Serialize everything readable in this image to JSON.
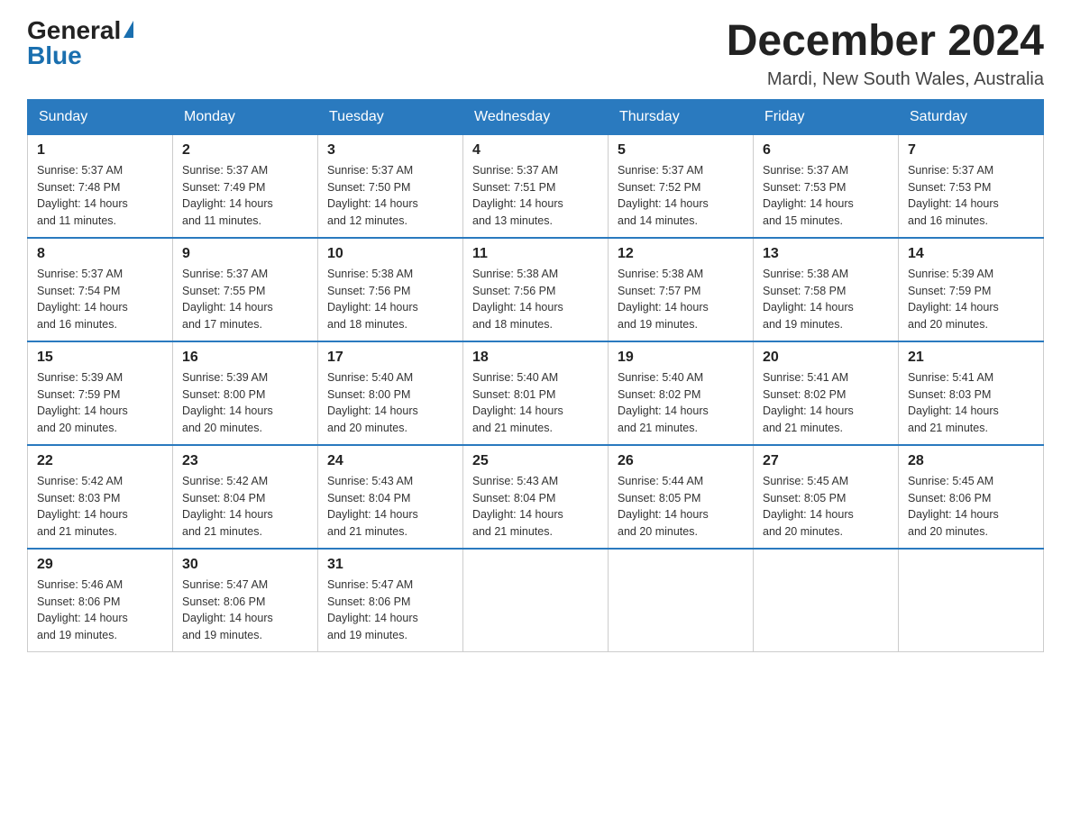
{
  "header": {
    "logo_general": "General",
    "logo_blue": "Blue",
    "month_title": "December 2024",
    "location": "Mardi, New South Wales, Australia"
  },
  "weekdays": [
    "Sunday",
    "Monday",
    "Tuesday",
    "Wednesday",
    "Thursday",
    "Friday",
    "Saturday"
  ],
  "weeks": [
    [
      {
        "day": "1",
        "sunrise": "5:37 AM",
        "sunset": "7:48 PM",
        "daylight": "14 hours and 11 minutes."
      },
      {
        "day": "2",
        "sunrise": "5:37 AM",
        "sunset": "7:49 PM",
        "daylight": "14 hours and 11 minutes."
      },
      {
        "day": "3",
        "sunrise": "5:37 AM",
        "sunset": "7:50 PM",
        "daylight": "14 hours and 12 minutes."
      },
      {
        "day": "4",
        "sunrise": "5:37 AM",
        "sunset": "7:51 PM",
        "daylight": "14 hours and 13 minutes."
      },
      {
        "day": "5",
        "sunrise": "5:37 AM",
        "sunset": "7:52 PM",
        "daylight": "14 hours and 14 minutes."
      },
      {
        "day": "6",
        "sunrise": "5:37 AM",
        "sunset": "7:53 PM",
        "daylight": "14 hours and 15 minutes."
      },
      {
        "day": "7",
        "sunrise": "5:37 AM",
        "sunset": "7:53 PM",
        "daylight": "14 hours and 16 minutes."
      }
    ],
    [
      {
        "day": "8",
        "sunrise": "5:37 AM",
        "sunset": "7:54 PM",
        "daylight": "14 hours and 16 minutes."
      },
      {
        "day": "9",
        "sunrise": "5:37 AM",
        "sunset": "7:55 PM",
        "daylight": "14 hours and 17 minutes."
      },
      {
        "day": "10",
        "sunrise": "5:38 AM",
        "sunset": "7:56 PM",
        "daylight": "14 hours and 18 minutes."
      },
      {
        "day": "11",
        "sunrise": "5:38 AM",
        "sunset": "7:56 PM",
        "daylight": "14 hours and 18 minutes."
      },
      {
        "day": "12",
        "sunrise": "5:38 AM",
        "sunset": "7:57 PM",
        "daylight": "14 hours and 19 minutes."
      },
      {
        "day": "13",
        "sunrise": "5:38 AM",
        "sunset": "7:58 PM",
        "daylight": "14 hours and 19 minutes."
      },
      {
        "day": "14",
        "sunrise": "5:39 AM",
        "sunset": "7:59 PM",
        "daylight": "14 hours and 20 minutes."
      }
    ],
    [
      {
        "day": "15",
        "sunrise": "5:39 AM",
        "sunset": "7:59 PM",
        "daylight": "14 hours and 20 minutes."
      },
      {
        "day": "16",
        "sunrise": "5:39 AM",
        "sunset": "8:00 PM",
        "daylight": "14 hours and 20 minutes."
      },
      {
        "day": "17",
        "sunrise": "5:40 AM",
        "sunset": "8:00 PM",
        "daylight": "14 hours and 20 minutes."
      },
      {
        "day": "18",
        "sunrise": "5:40 AM",
        "sunset": "8:01 PM",
        "daylight": "14 hours and 21 minutes."
      },
      {
        "day": "19",
        "sunrise": "5:40 AM",
        "sunset": "8:02 PM",
        "daylight": "14 hours and 21 minutes."
      },
      {
        "day": "20",
        "sunrise": "5:41 AM",
        "sunset": "8:02 PM",
        "daylight": "14 hours and 21 minutes."
      },
      {
        "day": "21",
        "sunrise": "5:41 AM",
        "sunset": "8:03 PM",
        "daylight": "14 hours and 21 minutes."
      }
    ],
    [
      {
        "day": "22",
        "sunrise": "5:42 AM",
        "sunset": "8:03 PM",
        "daylight": "14 hours and 21 minutes."
      },
      {
        "day": "23",
        "sunrise": "5:42 AM",
        "sunset": "8:04 PM",
        "daylight": "14 hours and 21 minutes."
      },
      {
        "day": "24",
        "sunrise": "5:43 AM",
        "sunset": "8:04 PM",
        "daylight": "14 hours and 21 minutes."
      },
      {
        "day": "25",
        "sunrise": "5:43 AM",
        "sunset": "8:04 PM",
        "daylight": "14 hours and 21 minutes."
      },
      {
        "day": "26",
        "sunrise": "5:44 AM",
        "sunset": "8:05 PM",
        "daylight": "14 hours and 20 minutes."
      },
      {
        "day": "27",
        "sunrise": "5:45 AM",
        "sunset": "8:05 PM",
        "daylight": "14 hours and 20 minutes."
      },
      {
        "day": "28",
        "sunrise": "5:45 AM",
        "sunset": "8:06 PM",
        "daylight": "14 hours and 20 minutes."
      }
    ],
    [
      {
        "day": "29",
        "sunrise": "5:46 AM",
        "sunset": "8:06 PM",
        "daylight": "14 hours and 19 minutes."
      },
      {
        "day": "30",
        "sunrise": "5:47 AM",
        "sunset": "8:06 PM",
        "daylight": "14 hours and 19 minutes."
      },
      {
        "day": "31",
        "sunrise": "5:47 AM",
        "sunset": "8:06 PM",
        "daylight": "14 hours and 19 minutes."
      },
      null,
      null,
      null,
      null
    ]
  ],
  "labels": {
    "sunrise": "Sunrise:",
    "sunset": "Sunset:",
    "daylight": "Daylight:"
  }
}
